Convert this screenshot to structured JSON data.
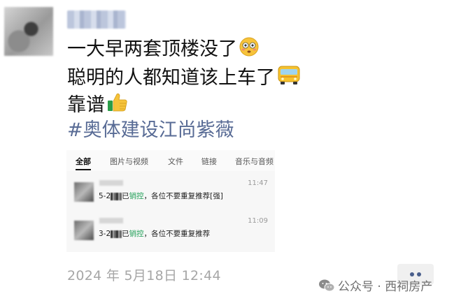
{
  "post": {
    "lines": [
      "一大早两套顶楼没了",
      "聪明的人都知道该上车了",
      "靠谱"
    ],
    "hashtag": "#奥体建设江尚紫薇",
    "timestamp": "2024 年 5月18日 12:44"
  },
  "emojis": {
    "line1": "flushed-face-icon",
    "line2": "bus-icon",
    "line3": "thumbs-up-icon"
  },
  "screenshot": {
    "tabs": [
      "全部",
      "图片与视频",
      "文件",
      "链接",
      "音乐与音频"
    ],
    "active_tab": "全部",
    "messages": [
      {
        "prefix": "5-2",
        "middle": "已",
        "highlight": "销控",
        "rest": "，各位不要重复推荐[强]",
        "time": "11:47"
      },
      {
        "prefix": "3-2",
        "middle": "已",
        "highlight": "销控",
        "rest": "，各位不要重复推荐",
        "time": "11:09"
      }
    ]
  },
  "watermark": {
    "text": "公众号 · 西祠房产"
  },
  "colors": {
    "hashtag": "#586b95",
    "highlight": "#1e9e55",
    "timestamp": "#a6a6a6"
  }
}
